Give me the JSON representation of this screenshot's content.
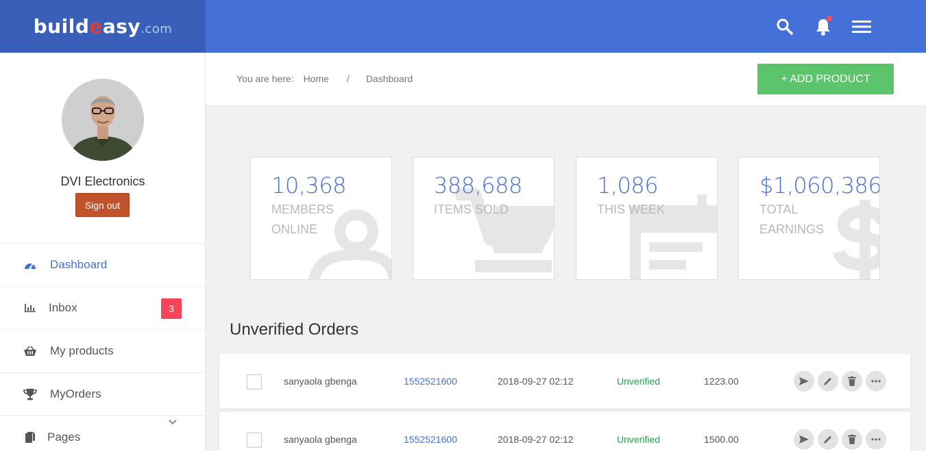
{
  "brand": {
    "name_prefix": "build",
    "name_accent": "e",
    "name_suffix": "asy",
    "tld": ".com"
  },
  "topbar": {
    "icons": [
      "search-icon",
      "bell-icon",
      "menu-icon"
    ]
  },
  "profile": {
    "name": "DVI Electronics",
    "signout_label": "Sign out"
  },
  "sidebar": {
    "items": [
      {
        "label": "Dashboard",
        "icon": "speedometer-icon"
      },
      {
        "label": "Inbox",
        "icon": "bar-chart-icon",
        "badge": "3"
      },
      {
        "label": "My products",
        "icon": "basket-icon"
      },
      {
        "label": "MyOrders",
        "icon": "trophy-icon"
      },
      {
        "label": "Pages",
        "icon": "pages-icon"
      }
    ]
  },
  "breadcrumb": {
    "prefix": "You are here:",
    "home": "Home",
    "separator": "/",
    "current": "Dashboard"
  },
  "add_product_label": "+ ADD PRODUCT",
  "stats": [
    {
      "value": "10,368",
      "label": "MEMBERS ONLINE",
      "icon": "user-icon"
    },
    {
      "value": "388,688",
      "label": "ITEMS SOLD",
      "icon": "cart-icon"
    },
    {
      "value": "1,086",
      "label": "THIS WEEK",
      "icon": "calendar-icon"
    },
    {
      "value": "$1,060,386",
      "label": "TOTAL EARNINGS",
      "icon": "dollar-icon"
    }
  ],
  "orders": {
    "title": "Unverified Orders",
    "rows": [
      {
        "name": "sanyaola gbenga",
        "phone": "1552521600",
        "date": "2018-09-27 02:12",
        "status": "Unverified",
        "amount": "1223.00"
      },
      {
        "name": "sanyaola gbenga",
        "phone": "1552521600",
        "date": "2018-09-27 02:12",
        "status": "Unverified",
        "amount": "1500.00"
      }
    ]
  },
  "colors": {
    "primary": "#4570d8",
    "brand_dark": "#3a5fb9",
    "success": "#5cc46a",
    "danger": "#f3465a",
    "signout": "#c0532b"
  }
}
